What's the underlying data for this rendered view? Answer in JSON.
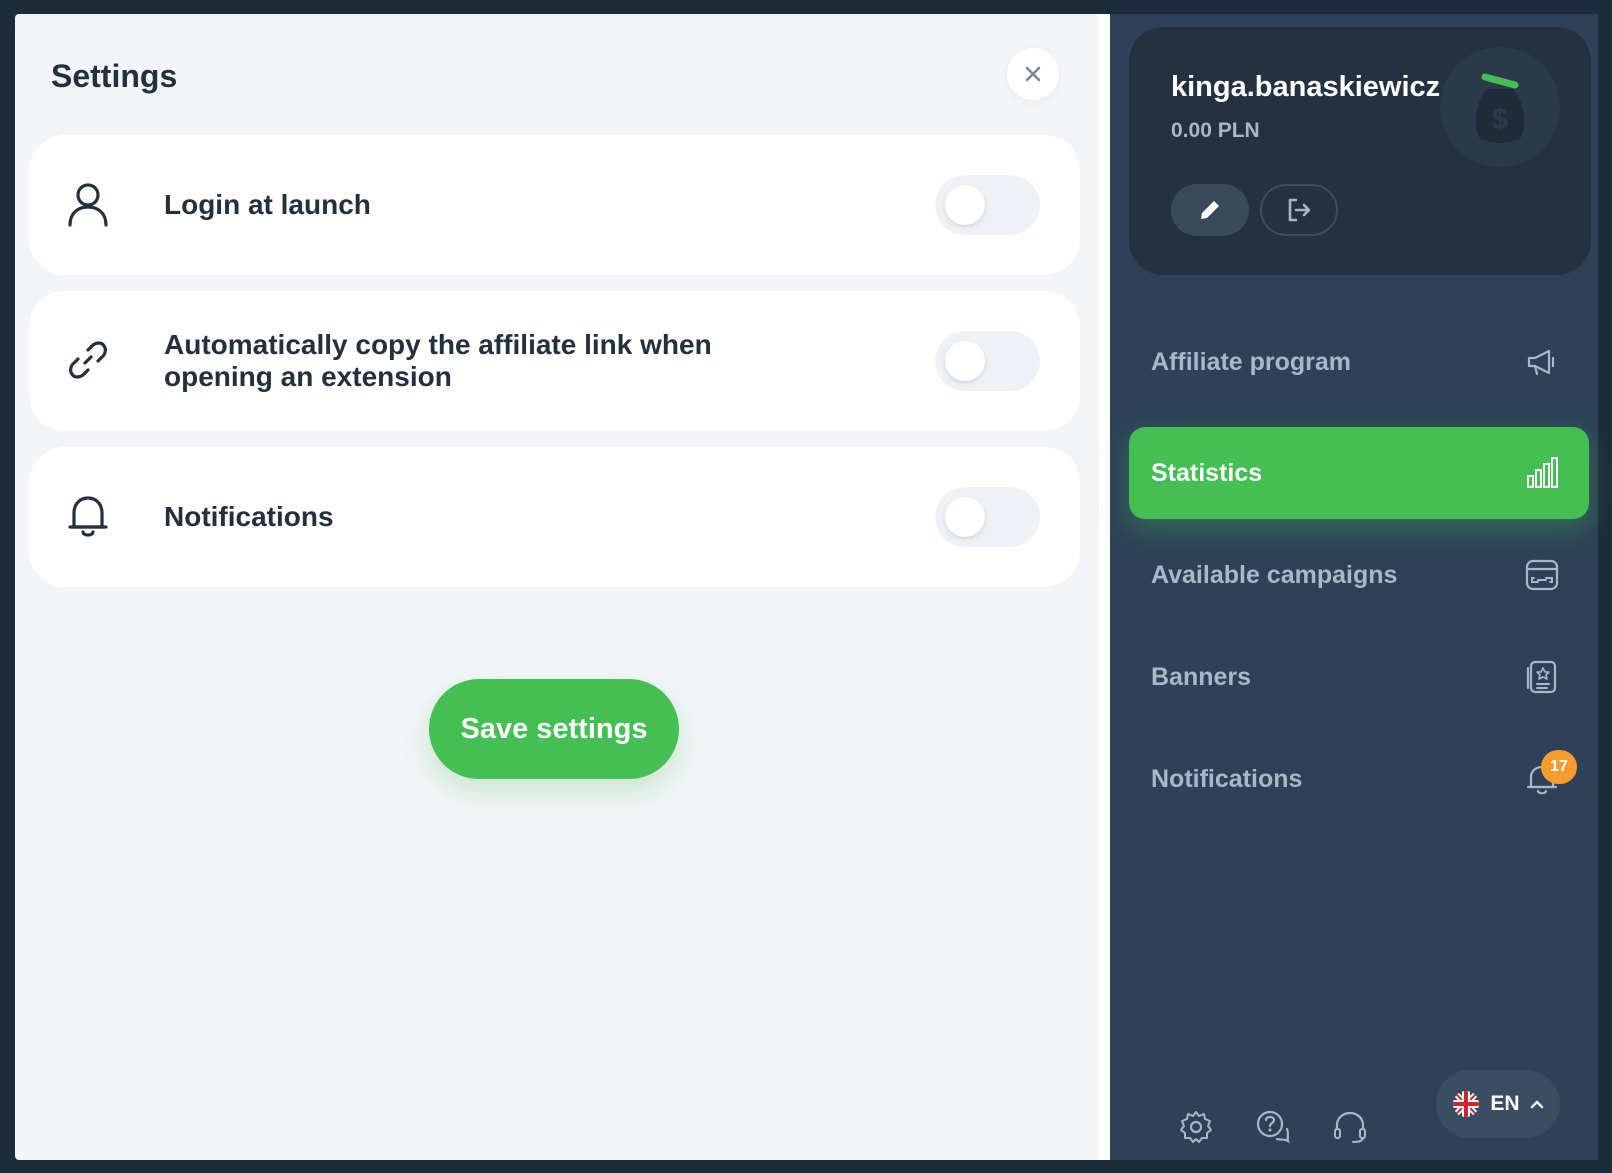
{
  "settings": {
    "title": "Settings",
    "close_icon": "close-icon",
    "options": [
      {
        "label": "Login at launch",
        "icon": "user-icon",
        "enabled": false
      },
      {
        "label": "Automatically copy the affiliate link when opening an extension",
        "icon": "link-icon",
        "enabled": false
      },
      {
        "label": "Notifications",
        "icon": "bell-icon",
        "enabled": false
      }
    ],
    "save_label": "Save settings"
  },
  "profile": {
    "username": "kinga.banaskiewicz",
    "balance": "0.00 PLN",
    "avatar_icon": "money-bag-icon",
    "edit_icon": "pencil-icon",
    "logout_icon": "logout-icon"
  },
  "nav": {
    "items": [
      {
        "label": "Affiliate program",
        "icon": "megaphone-icon",
        "active": false
      },
      {
        "label": "Statistics",
        "icon": "bar-chart-icon",
        "active": true
      },
      {
        "label": "Available campaigns",
        "icon": "campaign-icon",
        "active": false
      },
      {
        "label": "Banners",
        "icon": "banner-icon",
        "active": false
      },
      {
        "label": "Notifications",
        "icon": "bell-icon",
        "active": false,
        "badge": "17"
      }
    ]
  },
  "footer": {
    "icons": [
      "gear-icon",
      "help-chat-icon",
      "headset-icon"
    ],
    "language": "EN",
    "language_flag": "uk-flag-icon"
  },
  "colors": {
    "accent": "#43bf53",
    "sidebar": "#2d4258",
    "badge": "#f79b2c",
    "text_dark": "#23303d"
  }
}
